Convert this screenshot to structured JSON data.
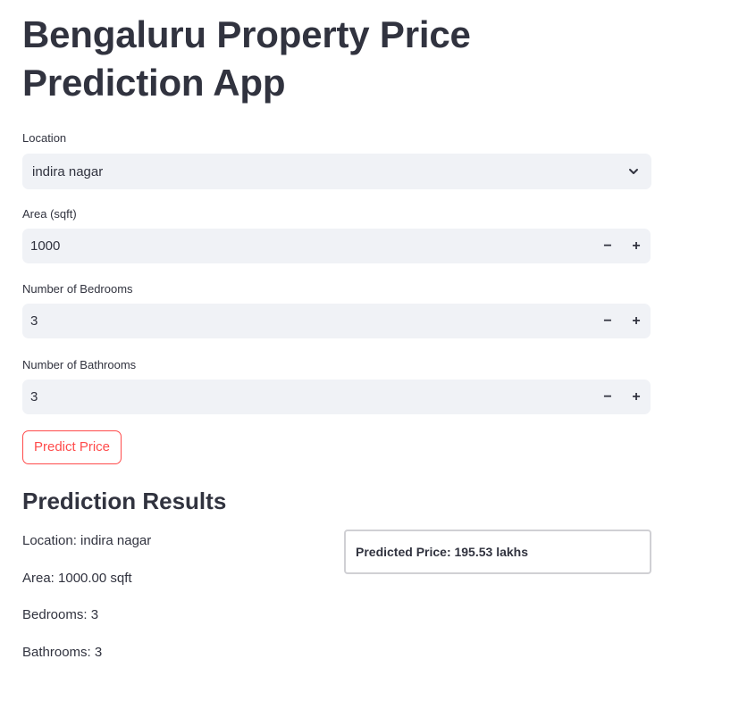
{
  "app": {
    "title": "Bengaluru Property Price Prediction App"
  },
  "form": {
    "location": {
      "label": "Location",
      "value": "indira nagar",
      "icon": "chevron-down-icon"
    },
    "area": {
      "label": "Area (sqft)",
      "value": "1000"
    },
    "bedrooms": {
      "label": "Number of Bedrooms",
      "value": "3"
    },
    "bathrooms": {
      "label": "Number of Bathrooms",
      "value": "3"
    },
    "stepper": {
      "minus": "−",
      "plus": "+"
    },
    "predict_button": "Predict Price"
  },
  "results": {
    "heading": "Prediction Results",
    "location_line": "Location: indira nagar",
    "area_line": "Area: 1000.00 sqft",
    "bedrooms_line": "Bedrooms: 3",
    "bathrooms_line": "Bathrooms: 3",
    "predicted_price": "Predicted Price: 195.53 lakhs"
  },
  "colors": {
    "accent": "#ff4b4b",
    "input_bg": "#f0f2f6",
    "text": "#31333f"
  }
}
